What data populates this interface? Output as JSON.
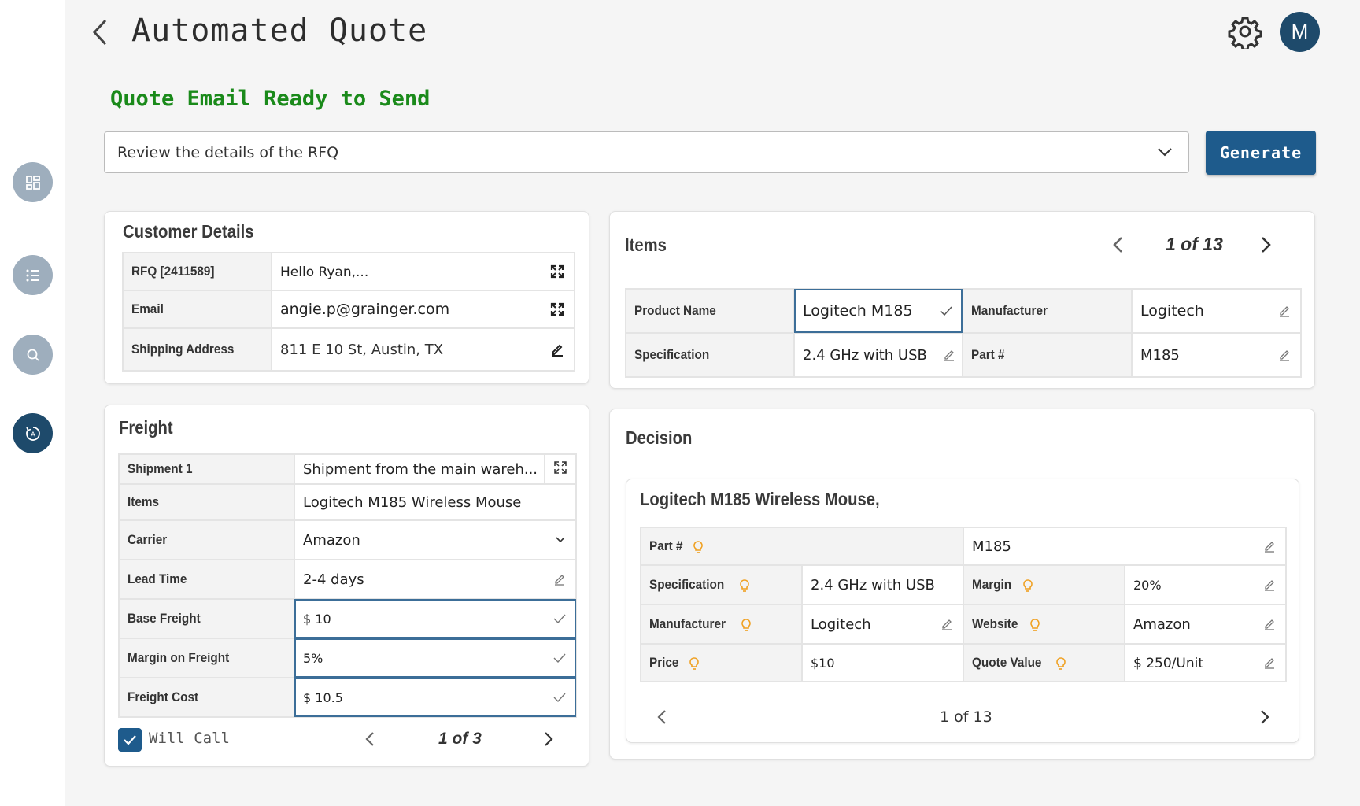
{
  "header": {
    "title": "Automated Quote",
    "avatar_initial": "M"
  },
  "status": {
    "title": "Quote Email Ready to Send",
    "color": "#1a8a1a"
  },
  "rfq_select": {
    "value": "Review the details of the RFQ"
  },
  "actions": {
    "generate_label": "Generate"
  },
  "customer": {
    "title": "Customer Details",
    "rows": [
      {
        "label": "RFQ [2411589]",
        "value": "Hello Ryan,..."
      },
      {
        "label": "Email",
        "value": "angie.p@grainger.com"
      },
      {
        "label": "Shipping Address",
        "value": "811 E 10 St, Austin, TX"
      }
    ]
  },
  "items": {
    "title": "Items",
    "pager": "1 of 13",
    "product_name_label": "Product Name",
    "product_name": "Logitech M185",
    "manufacturer_label": "Manufacturer",
    "manufacturer": "Logitech",
    "specification_label": "Specification",
    "specification": "2.4 GHz with USB",
    "part_label": "Part #",
    "part": "M185"
  },
  "freight": {
    "title": "Freight",
    "rows": [
      {
        "label": "Shipment 1",
        "value": "Shipment from the main wareh..."
      },
      {
        "label": "Items",
        "value": "Logitech M185 Wireless Mouse"
      },
      {
        "label": "Carrier",
        "value": "Amazon"
      },
      {
        "label": "Lead Time",
        "value": "2-4 days"
      },
      {
        "label": "Base Freight",
        "value": "$ 10"
      },
      {
        "label": "Margin on Freight",
        "value": "5%"
      },
      {
        "label": "Freight Cost",
        "value": "$ 10.5"
      }
    ],
    "will_call_label": "Will Call",
    "will_call_checked": true,
    "pager": "1 of 3"
  },
  "decision": {
    "title": "Decision",
    "product_title": "Logitech M185 Wireless Mouse,",
    "part_label": "Part #",
    "part": "M185",
    "specification_label": "Specification",
    "specification": "2.4 GHz with USB",
    "margin_label": "Margin",
    "margin": "20%",
    "manufacturer_label": "Manufacturer",
    "manufacturer": "Logitech",
    "website_label": "Website",
    "website": "Amazon",
    "price_label": "Price",
    "price": "$10",
    "quote_value_label": "Quote Value",
    "quote_value": "$ 250/Unit",
    "pager": "1 of 13"
  },
  "icons": {
    "sidebar": [
      "dashboard-icon",
      "list-icon",
      "search-icon",
      "automation-icon"
    ],
    "accent": "#1e5b8c",
    "bulb_color": "#f0a020"
  }
}
